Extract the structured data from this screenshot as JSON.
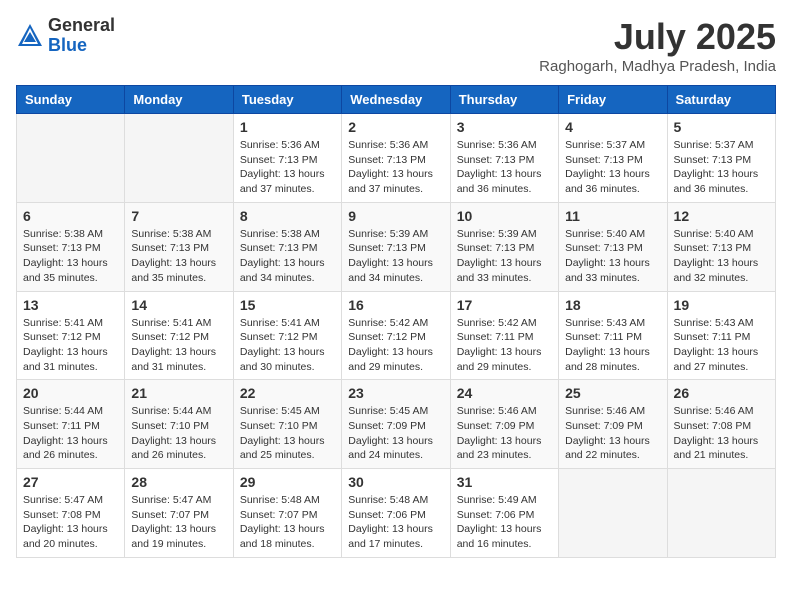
{
  "header": {
    "logo_general": "General",
    "logo_blue": "Blue",
    "month_title": "July 2025",
    "location": "Raghogarh, Madhya Pradesh, India"
  },
  "days_of_week": [
    "Sunday",
    "Monday",
    "Tuesday",
    "Wednesday",
    "Thursday",
    "Friday",
    "Saturday"
  ],
  "weeks": [
    [
      {
        "day": "",
        "info": ""
      },
      {
        "day": "",
        "info": ""
      },
      {
        "day": "1",
        "sunrise": "5:36 AM",
        "sunset": "7:13 PM",
        "daylight": "13 hours and 37 minutes."
      },
      {
        "day": "2",
        "sunrise": "5:36 AM",
        "sunset": "7:13 PM",
        "daylight": "13 hours and 37 minutes."
      },
      {
        "day": "3",
        "sunrise": "5:36 AM",
        "sunset": "7:13 PM",
        "daylight": "13 hours and 36 minutes."
      },
      {
        "day": "4",
        "sunrise": "5:37 AM",
        "sunset": "7:13 PM",
        "daylight": "13 hours and 36 minutes."
      },
      {
        "day": "5",
        "sunrise": "5:37 AM",
        "sunset": "7:13 PM",
        "daylight": "13 hours and 36 minutes."
      }
    ],
    [
      {
        "day": "6",
        "sunrise": "5:38 AM",
        "sunset": "7:13 PM",
        "daylight": "13 hours and 35 minutes."
      },
      {
        "day": "7",
        "sunrise": "5:38 AM",
        "sunset": "7:13 PM",
        "daylight": "13 hours and 35 minutes."
      },
      {
        "day": "8",
        "sunrise": "5:38 AM",
        "sunset": "7:13 PM",
        "daylight": "13 hours and 34 minutes."
      },
      {
        "day": "9",
        "sunrise": "5:39 AM",
        "sunset": "7:13 PM",
        "daylight": "13 hours and 34 minutes."
      },
      {
        "day": "10",
        "sunrise": "5:39 AM",
        "sunset": "7:13 PM",
        "daylight": "13 hours and 33 minutes."
      },
      {
        "day": "11",
        "sunrise": "5:40 AM",
        "sunset": "7:13 PM",
        "daylight": "13 hours and 33 minutes."
      },
      {
        "day": "12",
        "sunrise": "5:40 AM",
        "sunset": "7:13 PM",
        "daylight": "13 hours and 32 minutes."
      }
    ],
    [
      {
        "day": "13",
        "sunrise": "5:41 AM",
        "sunset": "7:12 PM",
        "daylight": "13 hours and 31 minutes."
      },
      {
        "day": "14",
        "sunrise": "5:41 AM",
        "sunset": "7:12 PM",
        "daylight": "13 hours and 31 minutes."
      },
      {
        "day": "15",
        "sunrise": "5:41 AM",
        "sunset": "7:12 PM",
        "daylight": "13 hours and 30 minutes."
      },
      {
        "day": "16",
        "sunrise": "5:42 AM",
        "sunset": "7:12 PM",
        "daylight": "13 hours and 29 minutes."
      },
      {
        "day": "17",
        "sunrise": "5:42 AM",
        "sunset": "7:11 PM",
        "daylight": "13 hours and 29 minutes."
      },
      {
        "day": "18",
        "sunrise": "5:43 AM",
        "sunset": "7:11 PM",
        "daylight": "13 hours and 28 minutes."
      },
      {
        "day": "19",
        "sunrise": "5:43 AM",
        "sunset": "7:11 PM",
        "daylight": "13 hours and 27 minutes."
      }
    ],
    [
      {
        "day": "20",
        "sunrise": "5:44 AM",
        "sunset": "7:11 PM",
        "daylight": "13 hours and 26 minutes."
      },
      {
        "day": "21",
        "sunrise": "5:44 AM",
        "sunset": "7:10 PM",
        "daylight": "13 hours and 26 minutes."
      },
      {
        "day": "22",
        "sunrise": "5:45 AM",
        "sunset": "7:10 PM",
        "daylight": "13 hours and 25 minutes."
      },
      {
        "day": "23",
        "sunrise": "5:45 AM",
        "sunset": "7:09 PM",
        "daylight": "13 hours and 24 minutes."
      },
      {
        "day": "24",
        "sunrise": "5:46 AM",
        "sunset": "7:09 PM",
        "daylight": "13 hours and 23 minutes."
      },
      {
        "day": "25",
        "sunrise": "5:46 AM",
        "sunset": "7:09 PM",
        "daylight": "13 hours and 22 minutes."
      },
      {
        "day": "26",
        "sunrise": "5:46 AM",
        "sunset": "7:08 PM",
        "daylight": "13 hours and 21 minutes."
      }
    ],
    [
      {
        "day": "27",
        "sunrise": "5:47 AM",
        "sunset": "7:08 PM",
        "daylight": "13 hours and 20 minutes."
      },
      {
        "day": "28",
        "sunrise": "5:47 AM",
        "sunset": "7:07 PM",
        "daylight": "13 hours and 19 minutes."
      },
      {
        "day": "29",
        "sunrise": "5:48 AM",
        "sunset": "7:07 PM",
        "daylight": "13 hours and 18 minutes."
      },
      {
        "day": "30",
        "sunrise": "5:48 AM",
        "sunset": "7:06 PM",
        "daylight": "13 hours and 17 minutes."
      },
      {
        "day": "31",
        "sunrise": "5:49 AM",
        "sunset": "7:06 PM",
        "daylight": "13 hours and 16 minutes."
      },
      {
        "day": "",
        "info": ""
      },
      {
        "day": "",
        "info": ""
      }
    ]
  ]
}
